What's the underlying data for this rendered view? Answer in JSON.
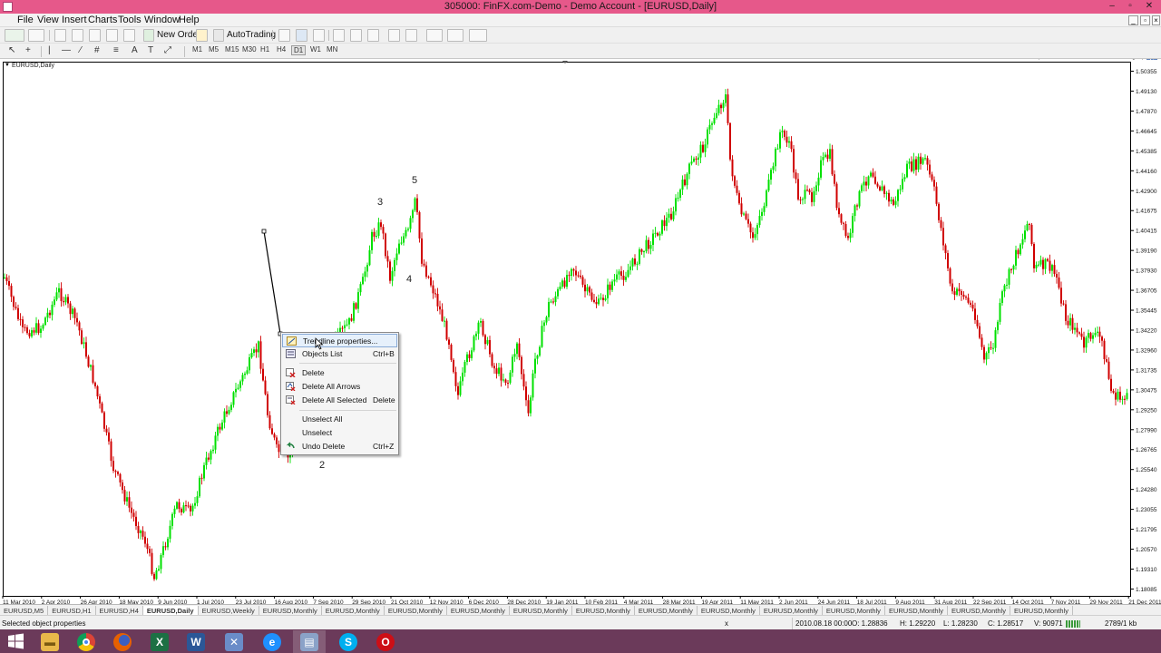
{
  "window": {
    "title": "305000: FinFX.com-Demo - Demo Account - [EURUSD,Daily]",
    "controls": [
      "–",
      "▫",
      "✕"
    ]
  },
  "menu": {
    "items": [
      "File",
      "View",
      "Insert",
      "Charts",
      "Tools",
      "Window",
      "Help"
    ]
  },
  "toolbar": {
    "new_order_label": "New Order",
    "autotrading_label": "AutoTrading",
    "timeframes": [
      "M1",
      "M5",
      "M15",
      "M30",
      "H1",
      "H4",
      "D1",
      "W1",
      "MN"
    ],
    "search_placeholder": ""
  },
  "chart": {
    "symbol_label": "EURUSD,Daily",
    "wave_labels": [
      "3",
      "5",
      "4",
      "2"
    ],
    "price_ticks": [
      "1.50355",
      "1.49130",
      "1.47870",
      "1.46645",
      "1.45385",
      "1.44160",
      "1.42900",
      "1.41675",
      "1.40415",
      "1.39190",
      "1.37930",
      "1.36705",
      "1.35445",
      "1.34220",
      "1.32960",
      "1.31735",
      "1.30475",
      "1.29250",
      "1.27990",
      "1.26765",
      "1.25540",
      "1.24280",
      "1.23055",
      "1.21795",
      "1.20570",
      "1.19310",
      "1.18085"
    ],
    "date_ticks": [
      "11 Mar 2010",
      "2 Apr 2010",
      "26 Apr 2010",
      "18 May 2010",
      "9 Jun 2010",
      "1 Jul 2010",
      "23 Jul 2010",
      "16 Aug 2010",
      "7 Sep 2010",
      "29 Sep 2010",
      "21 Oct 2010",
      "12 Nov 2010",
      "6 Dec 2010",
      "28 Dec 2010",
      "19 Jan 2011",
      "10 Feb 2011",
      "4 Mar 2011",
      "28 Mar 2011",
      "19 Apr 2011",
      "11 May 2011",
      "2 Jun 2011",
      "24 Jun 2011",
      "18 Jul 2011",
      "9 Aug 2011",
      "31 Aug 2011",
      "22 Sep 2011",
      "14 Oct 2011",
      "7 Nov 2011",
      "29 Nov 2011",
      "21 Dec 2011"
    ],
    "bull_color": "#00e000",
    "bear_color": "#d00000"
  },
  "context_menu": {
    "items": [
      {
        "label": "Trendline properties...",
        "shortcut": "",
        "icon": "trendline-properties-icon"
      },
      {
        "label": "Objects List",
        "shortcut": "Ctrl+B",
        "icon": "objects-list-icon"
      },
      {
        "label": "Delete",
        "shortcut": "",
        "icon": "delete-icon"
      },
      {
        "label": "Delete All Arrows",
        "shortcut": "",
        "icon": "delete-arrows-icon"
      },
      {
        "label": "Delete All Selected",
        "shortcut": "Delete",
        "icon": "delete-selected-icon"
      },
      {
        "label": "Unselect All",
        "shortcut": "",
        "icon": ""
      },
      {
        "label": "Unselect",
        "shortcut": "",
        "icon": ""
      },
      {
        "label": "Undo Delete",
        "shortcut": "Ctrl+Z",
        "icon": "undo-icon"
      }
    ]
  },
  "tabs": [
    "EURUSD,M5",
    "EURUSD,H1",
    "EURUSD,H4",
    "EURUSD,Daily",
    "EURUSD,Weekly",
    "EURUSD,Monthly",
    "EURUSD,Monthly",
    "EURUSD,Monthly",
    "EURUSD,Monthly",
    "EURUSD,Monthly",
    "EURUSD,Monthly",
    "EURUSD,Monthly",
    "EURUSD,Monthly",
    "EURUSD,Monthly",
    "EURUSD,Monthly",
    "EURUSD,Monthly",
    "EURUSD,Monthly",
    "EURUSD,Monthly"
  ],
  "status": {
    "message": "Selected object properties",
    "x_label": "x",
    "datetime": "2010.08.18 00:00",
    "open": "O: 1.28836",
    "high": "H: 1.29220",
    "low": "L: 1.28230",
    "close": "C: 1.28517",
    "volume": "V: 90971",
    "traffic": "2789/1 kb"
  },
  "taskbar": {
    "apps": [
      "file-explorer-icon",
      "chrome-icon",
      "firefox-icon",
      "excel-icon",
      "word-icon",
      "metatrader-icon",
      "internet-explorer-icon",
      "mt4-terminal-icon",
      "skype-icon",
      "opera-icon"
    ]
  }
}
